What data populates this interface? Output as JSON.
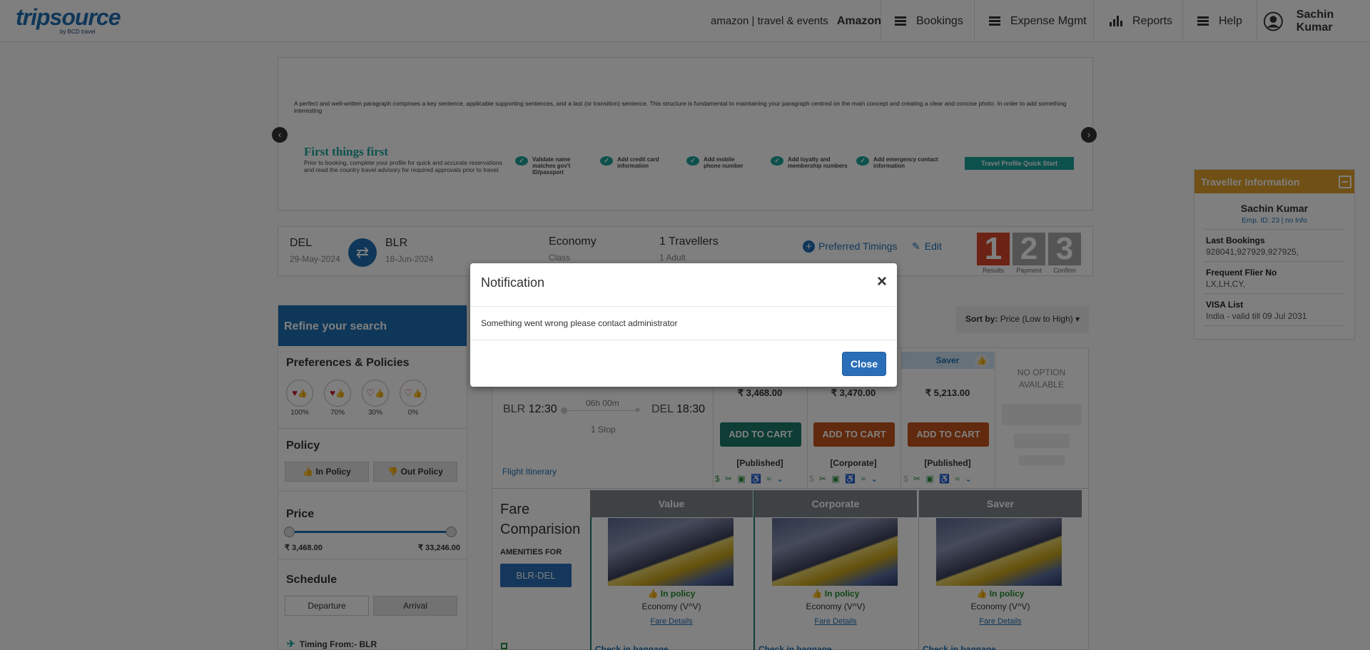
{
  "header": {
    "logo_main": "tripsource",
    "logo_sub": "by BCD travel",
    "amazon_brand": "amazon | travel & events",
    "company": "Amazon",
    "nav": [
      "Bookings",
      "Expense Mgmt",
      "Reports",
      "Help"
    ],
    "user": "Sachin Kumar"
  },
  "banner": {
    "paragraph": "A perfect and well-written paragraph comprises a key sentence, applicable supporting sentences, and a last (or transition) sentence. This structure is fundamental to maintaining your paragraph centred on the main concept and creating a clear and concise photo. In order to add something interesting",
    "title": "First things first",
    "text": "Prior to booking, complete your profile for quick and accurate reservations and read the country travel advisory for required approvals prior to travel.",
    "checks": [
      "Validate name matches gov't ID/passport",
      "Add credit card information",
      "Add mobile phone number",
      "Add loyalty and membership numbers",
      "Add emergency contact information"
    ],
    "quick_start": "Travel Profile Quick Start"
  },
  "search": {
    "from_code": "DEL",
    "from_date": "29-May-2024",
    "to_code": "BLR",
    "to_date": "18-Jun-2024",
    "class_value": "Economy",
    "class_label": "Class",
    "travellers": "1 Travellers",
    "travellers_detail": "1 Adult",
    "preferred_timings": "Preferred Timings",
    "edit": "Edit",
    "steps": [
      {
        "num": "1",
        "label": "Results",
        "color": "#d9472b"
      },
      {
        "num": "2",
        "label": "Payment",
        "color": "#a9a9a9"
      },
      {
        "num": "3",
        "label": "Confirm",
        "color": "#a9a9a9"
      }
    ]
  },
  "sidebar": {
    "refine": "Refine your search",
    "preferences_title": "Preferences & Policies",
    "prefs": [
      "100%",
      "70%",
      "30%",
      "0%"
    ],
    "policy_title": "Policy",
    "in_policy": "In Policy",
    "out_policy": "Out Policy",
    "price_title": "Price",
    "price_min": "₹ 3,468.00",
    "price_max": "₹ 33,246.00",
    "schedule_title": "Schedule",
    "departure": "Departure",
    "arrival": "Arrival",
    "timing_from": "Timing From:- BLR"
  },
  "sort": {
    "label": "Sort by:",
    "value": "Price (Low to High)"
  },
  "flight": {
    "dep_code": "BLR",
    "dep_time": "12:30",
    "duration": "06h 00m",
    "arr_code": "DEL",
    "arr_time": "18:30",
    "stops": "1 Stop",
    "itinerary": "Flight Itinerary",
    "saver_tag": "Saver",
    "no_option": "NO OPTION AVAILABLE",
    "fares": [
      {
        "price": "₹ 3,468.00",
        "button": "ADD TO CART",
        "type": "[Published]",
        "color": "#1a7a6a"
      },
      {
        "price": "₹ 3,470.00",
        "button": "ADD TO CART",
        "type": "[Corporate]",
        "color": "#c2531b"
      },
      {
        "price": "₹ 5,213.00",
        "button": "ADD TO CART",
        "type": "[Published]",
        "color": "#c2531b"
      }
    ]
  },
  "comparison": {
    "title": "Fare Comparision",
    "amenities": "AMENITIES FOR",
    "route": "BLR-DEL",
    "columns": [
      {
        "name": "Value",
        "policy": "In policy",
        "cabin": "Economy (V^V)",
        "details": "Fare Details",
        "baggage": "Check in baggage"
      },
      {
        "name": "Corporate",
        "policy": "In policy",
        "cabin": "Economy (V^V)",
        "details": "Fare Details",
        "baggage": "Check in baggage"
      },
      {
        "name": "Saver",
        "policy": "In policy",
        "cabin": "Economy (V^V)",
        "details": "Fare Details",
        "baggage": "Check in baggage"
      }
    ]
  },
  "traveller": {
    "header": "Traveller Information",
    "name": "Sachin Kumar",
    "emp": "Emp. ID: 23 | no Info",
    "last_bookings_label": "Last Bookings",
    "last_bookings": "928041,927929,927925,",
    "ff_label": "Frequent Flier No",
    "ff": "LX,LH,CY,",
    "visa_label": "VISA List",
    "visa": "India - valid till 09 Jul 2031"
  },
  "modal": {
    "title": "Notification",
    "message": "Something went wrong please contact administrator",
    "close_button": "Close",
    "close_icon": "×"
  }
}
